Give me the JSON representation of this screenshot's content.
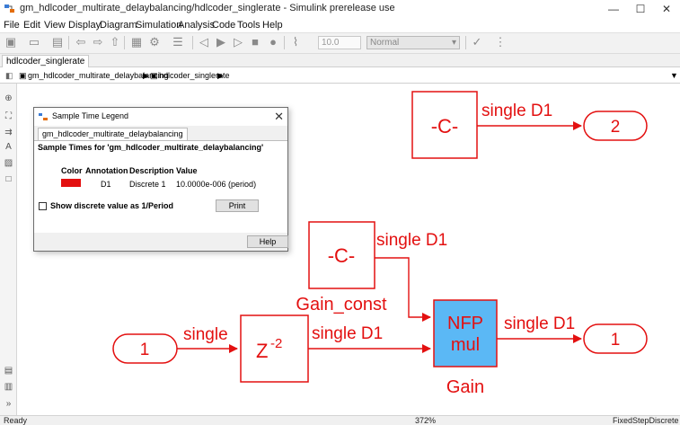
{
  "window": {
    "title": "gm_hdlcoder_multirate_delaybalancing/hdlcoder_singlerate - Simulink prerelease use",
    "controls": [
      "—",
      "☐",
      "✕"
    ]
  },
  "menu": [
    "File",
    "Edit",
    "View",
    "Display",
    "Diagram",
    "Simulation",
    "Analysis",
    "Code",
    "Tools",
    "Help"
  ],
  "toolbar": {
    "stop_time": "10.0",
    "sim_mode": "Normal"
  },
  "tab": {
    "label": "hdlcoder_singlerate"
  },
  "breadcrumb": {
    "items": [
      "gm_hdlcoder_multirate_delaybalancing",
      "hdlcoder_singlerate"
    ]
  },
  "dialog": {
    "title": "Sample Time Legend",
    "tab": "gm_hdlcoder_multirate_delaybalancing",
    "heading": "Sample Times for 'gm_hdlcoder_multirate_delaybalancing'",
    "columns": [
      "Color",
      "Annotation",
      "Description",
      "Value"
    ],
    "rows": [
      {
        "color": "#e31010",
        "annotation": "D1",
        "description": "Discrete 1",
        "value": "10.0000e-006  (period)"
      }
    ],
    "checkbox_label": "Show discrete value as 1/Period",
    "checkbox_checked": false,
    "print_label": "Print",
    "help_label": "Help"
  },
  "diagram": {
    "accent_color": "#e31010",
    "product_fill": "#5bb8f5",
    "const_top_label": "-C-",
    "const_top_signal": "single D1",
    "outport_2_label": "2",
    "const_gain_label": "-C-",
    "const_gain_signal": "single D1",
    "const_gain_name": "Gain_const",
    "inport_1_label": "1",
    "inport_signal": "single",
    "delay_label": "Z",
    "delay_exponent": "-2",
    "delay_signal": "single D1",
    "product_line1": "NFP",
    "product_line2": "mul",
    "product_name": "Gain",
    "product_signal": "single D1",
    "outport_1_label": "1"
  },
  "status": {
    "left": "Ready",
    "zoom": "372%",
    "solver": "FixedStepDiscrete"
  }
}
